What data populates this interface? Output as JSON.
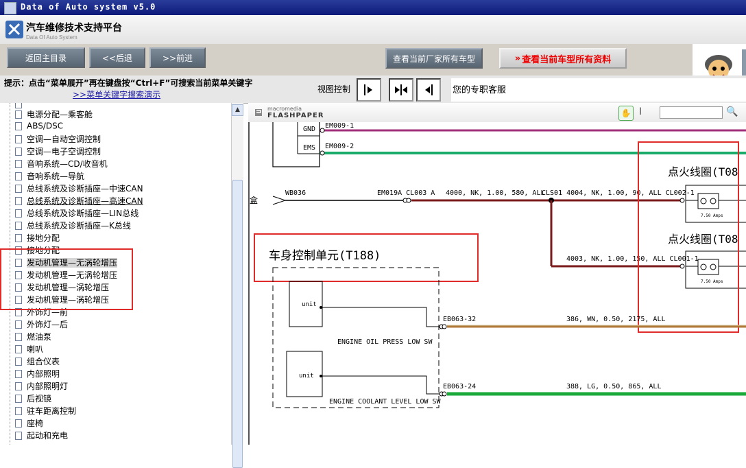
{
  "window": {
    "title": "Data of Auto system v5.0"
  },
  "header": {
    "app_name": "汽车维修技术支持平台",
    "app_sub": "Data Of Auto System"
  },
  "toolbar": {
    "home": "返回主目录",
    "back": "<<后退",
    "forward": ">>前进",
    "all_models": "查看当前厂家所有车型",
    "all_data": "查看当前车型所有资料"
  },
  "hintbar": {
    "hint": "提示：点击“菜单展开”再在键盘按“Ctrl+F”可搜索当前菜单关键字",
    "demo_link": ">>菜单关键字搜索演示",
    "view_control": "视图控制",
    "service": "您的专职客服"
  },
  "tree": {
    "items": [
      {
        "label": "电源分配—乘客舱"
      },
      {
        "label": "ABS/DSC"
      },
      {
        "label": "空调—自动空调控制"
      },
      {
        "label": "空调—电子空调控制"
      },
      {
        "label": "音响系统—CD/收音机"
      },
      {
        "label": "音响系统—导航"
      },
      {
        "label": "总线系统及诊断插座—中速CAN"
      },
      {
        "label": "总线系统及诊断插座—高速CAN"
      },
      {
        "label": "总线系统及诊断插座—LIN总线"
      },
      {
        "label": "总线系统及诊断插座—K总线"
      },
      {
        "label": "接地分配"
      },
      {
        "label": "接地分配"
      },
      {
        "label": "发动机管理—无涡轮增压"
      },
      {
        "label": "发动机管理—无涡轮增压"
      },
      {
        "label": "发动机管理—涡轮增压"
      },
      {
        "label": "发动机管理—涡轮增压"
      },
      {
        "label": "外饰灯—前"
      },
      {
        "label": "外饰灯—后"
      },
      {
        "label": "燃油泵"
      },
      {
        "label": "喇叭"
      },
      {
        "label": "组合仪表"
      },
      {
        "label": "内部照明"
      },
      {
        "label": "内部照明灯"
      },
      {
        "label": "后视镜"
      },
      {
        "label": "驻车距离控制"
      },
      {
        "label": "座椅"
      },
      {
        "label": "起动和充电"
      }
    ]
  },
  "flashpaper": {
    "macromedia": "macromedia",
    "brand": "FLASHPAPER"
  },
  "diagram": {
    "gnd": "GND",
    "ems": "EMS",
    "em009_1": "EM009-1",
    "em009_2": "EM009-2",
    "wb036": "WB036",
    "box_frag": "盒",
    "em019a": "EM019A CL003 A",
    "wire_4000": "4000, NK, 1.00, 580, ALL",
    "cls01": "CLS01 4004, NK, 1.00, 90, ALL CL002-1",
    "coil1": "点火线圈(T08",
    "coil2": "点火线圈(T08",
    "amps1": "7.50 Amps",
    "amps2": "7.50 Amps",
    "wire_4003": "4003, NK, 1.00, 150, ALL CL001-1",
    "bcm_title": "车身控制单元(T188)",
    "unit1": "unit",
    "unit2": "unit",
    "eb063_32": "EB063-32",
    "wire_386": "386, WN, 0.50, 2175, ALL",
    "oil_sw": "ENGINE OIL PRESS LOW SW",
    "eb063_24": "EB063-24",
    "wire_388": "388, LG, 0.50, 865, ALL",
    "coolant_sw": "ENGINE COOLANT LEVEL LOW SW"
  }
}
